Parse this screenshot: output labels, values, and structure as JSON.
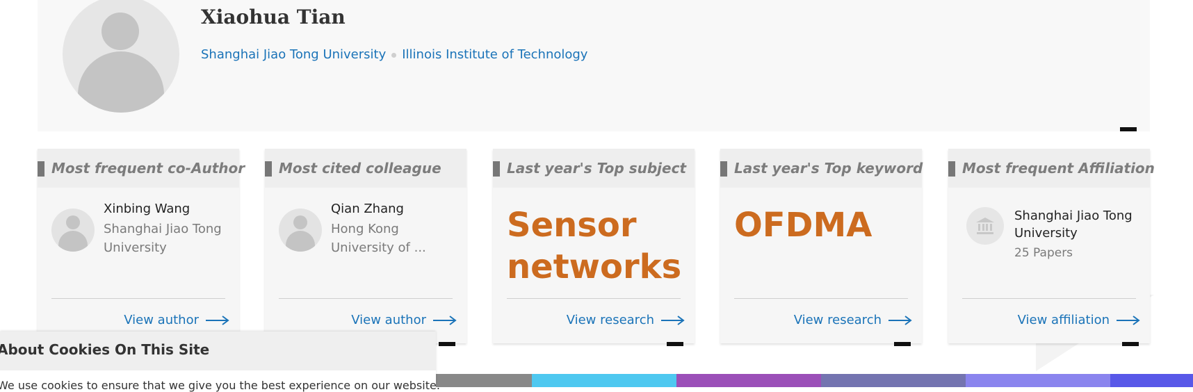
{
  "profile": {
    "name": "Xiaohua Tian",
    "affiliations": [
      "Shanghai Jiao Tong University",
      "Illinois Institute of Technology"
    ]
  },
  "cards": [
    {
      "title": "Most frequent co-Author",
      "person_name": "Xinbing Wang",
      "person_affiliation": "Shanghai Jiao Tong University",
      "link": "View author"
    },
    {
      "title": "Most cited colleague",
      "person_name": "Qian Zhang",
      "person_affiliation": "Hong Kong University of ...",
      "link": "View author"
    },
    {
      "title": "Last year's Top subject",
      "value": "Sensor networks",
      "link": "View research"
    },
    {
      "title": "Last year's Top keyword",
      "value": "OFDMA",
      "link": "View research"
    },
    {
      "title": "Most frequent Affiliation",
      "affiliation_name": "Shanghai Jiao Tong University",
      "papers": "25 Papers",
      "link": "View affiliation"
    }
  ],
  "cookie_banner": {
    "title": "About Cookies On This Site",
    "body": "We use cookies to ensure that we give you the best experience on our website."
  },
  "colors": {
    "accent_link": "#1a73b8",
    "highlight_orange": "#cc6b1f",
    "stripe": [
      "#888888",
      "#4ec8f0",
      "#9b4fb8",
      "#7474b0",
      "#8a84ee",
      "#5858e8"
    ]
  }
}
